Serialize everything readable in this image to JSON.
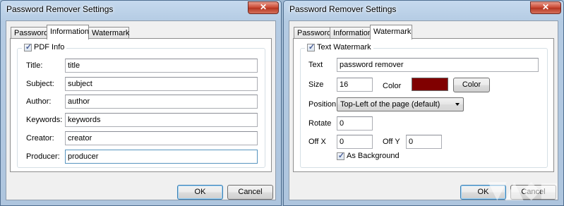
{
  "colors": {
    "titlebar": "#b9d1ea",
    "close_button": "#c8452f",
    "watermark_color": "#800000"
  },
  "left_window": {
    "title": "Password Remover Settings",
    "close_symbol": "✕",
    "tabs": [
      {
        "label": "Password",
        "active": false
      },
      {
        "label": "Information",
        "active": true
      },
      {
        "label": "Watermark",
        "active": false
      }
    ],
    "group": {
      "label": "PDF Info",
      "checked": true
    },
    "fields": [
      {
        "label": "Title:",
        "value": "title"
      },
      {
        "label": "Subject:",
        "value": "subject"
      },
      {
        "label": "Author:",
        "value": "author"
      },
      {
        "label": "Keywords:",
        "value": "keywords"
      },
      {
        "label": "Creator:",
        "value": "creator"
      },
      {
        "label": "Producer:",
        "value": "producer"
      }
    ],
    "ok_label": "OK",
    "cancel_label": "Cancel"
  },
  "right_window": {
    "title": "Password Remover Settings",
    "close_symbol": "✕",
    "tabs": [
      {
        "label": "Password",
        "active": false
      },
      {
        "label": "Information",
        "active": false
      },
      {
        "label": "Watermark",
        "active": true
      }
    ],
    "group": {
      "label": "Text Watermark",
      "checked": true
    },
    "text_label": "Text",
    "text_value": "password remover",
    "size_label": "Size",
    "size_value": "16",
    "color_label": "Color",
    "color_button": "Color",
    "position_label": "Position",
    "position_value": "Top-Left of the page (default)",
    "rotate_label": "Rotate",
    "rotate_value": "0",
    "offx_label": "Off X",
    "offx_value": "0",
    "offy_label": "Off Y",
    "offy_value": "0",
    "as_background_label": "As Background",
    "as_background_checked": true,
    "ok_label": "OK",
    "cancel_label": "Cancel"
  },
  "check_symbol": "✓"
}
